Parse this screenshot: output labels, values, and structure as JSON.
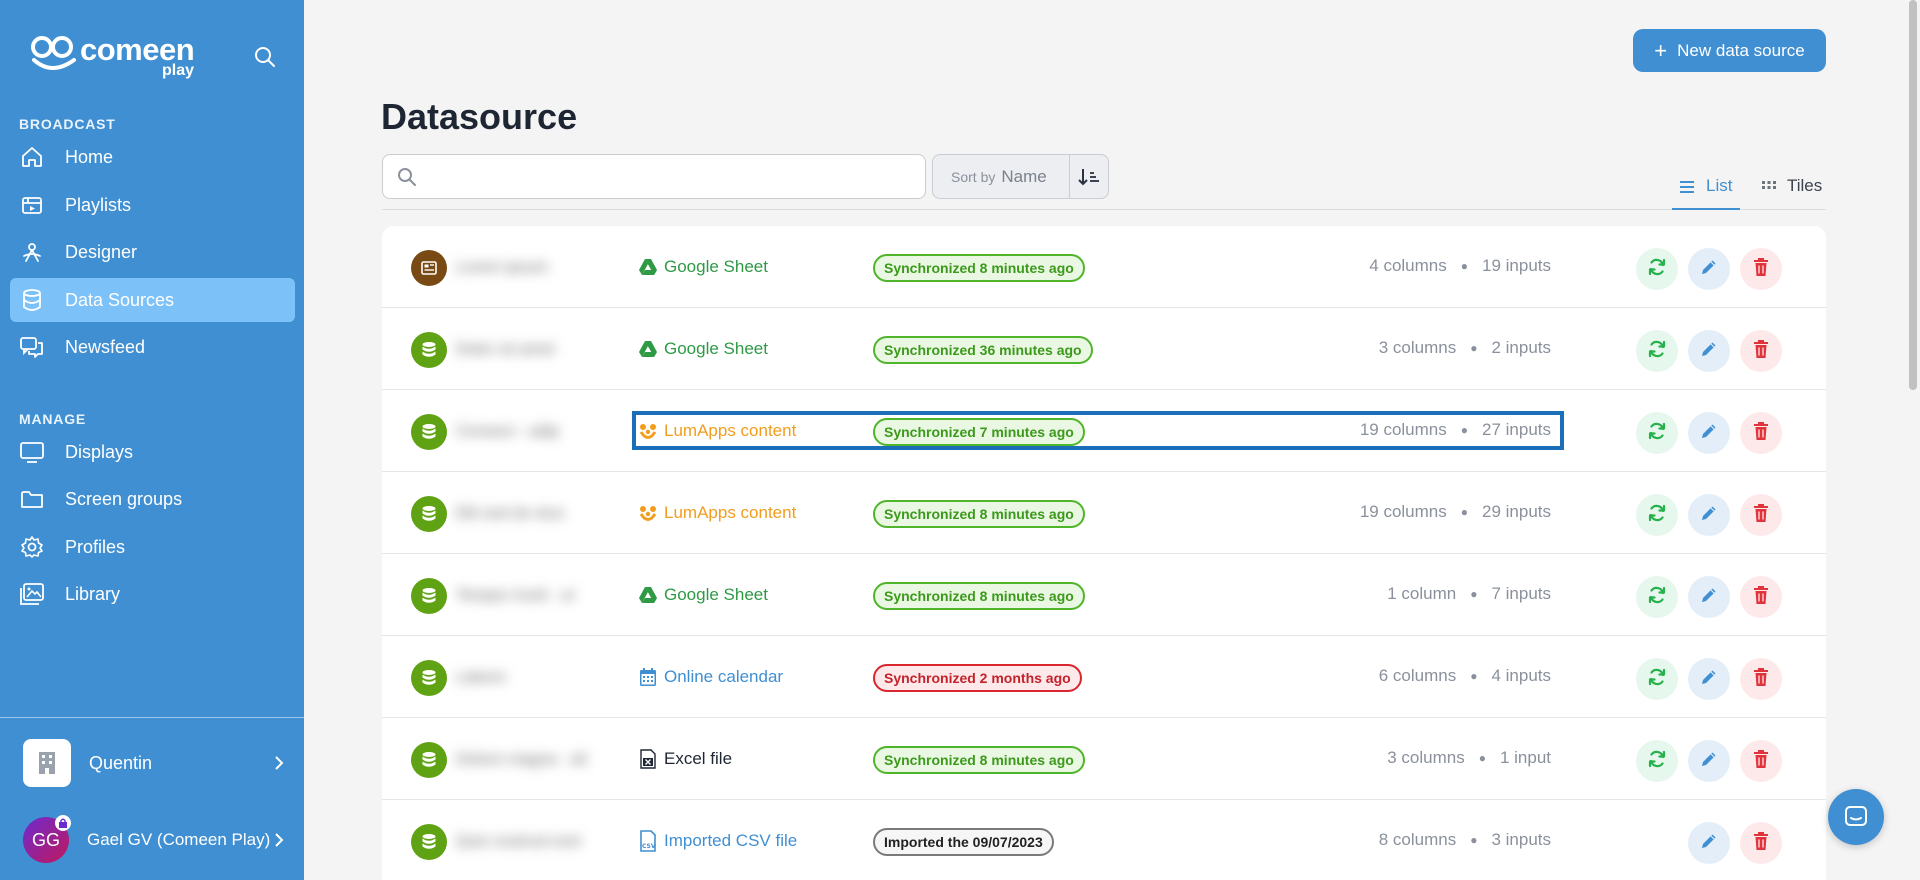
{
  "brand": {
    "name": "comeen",
    "sub": "play"
  },
  "sidebar": {
    "sections": [
      {
        "label": "BROADCAST"
      },
      {
        "label": "MANAGE"
      }
    ],
    "items": [
      {
        "label": "Home",
        "icon": "home-icon"
      },
      {
        "label": "Playlists",
        "icon": "playlist-icon"
      },
      {
        "label": "Designer",
        "icon": "designer-icon"
      },
      {
        "label": "Data Sources",
        "icon": "database-icon",
        "active": true
      },
      {
        "label": "Newsfeed",
        "icon": "newsfeed-icon"
      },
      {
        "label": "Displays",
        "icon": "display-icon"
      },
      {
        "label": "Screen groups",
        "icon": "folder-icon"
      },
      {
        "label": "Profiles",
        "icon": "gear-icon"
      },
      {
        "label": "Library",
        "icon": "library-icon"
      }
    ],
    "org": {
      "name": "Quentin"
    },
    "user": {
      "initials": "GG",
      "name": "Gael GV (Comeen Play)"
    }
  },
  "header": {
    "new_button": "New data source",
    "title": "Datasource"
  },
  "toolbar": {
    "search_placeholder": "",
    "sort_by_label": "Sort by",
    "sort_value": "Name",
    "view_list": "List",
    "view_tiles": "Tiles"
  },
  "rows": [
    {
      "name": "Lorem ipsum",
      "avatar_color": "#7a4a14",
      "avatar_icon": "news-icon",
      "type": "Google Sheet",
      "type_icon": "google-drive-icon",
      "type_color": "#2e9a46",
      "status": "Synchronized 8 minutes ago",
      "status_kind": "ok",
      "columns": "4 columns",
      "inputs": "19 inputs",
      "sync": true
    },
    {
      "name": "Dolor sit amet",
      "avatar_color": "#5fa314",
      "avatar_icon": "database-icon",
      "type": "Google Sheet",
      "type_icon": "google-drive-icon",
      "type_color": "#2e9a46",
      "status": "Synchronized 36 minutes ago",
      "status_kind": "ok",
      "columns": "3 columns",
      "inputs": "2 inputs",
      "sync": true
    },
    {
      "name": "Consect - adip",
      "avatar_color": "#5fa314",
      "avatar_icon": "database-icon",
      "type": "LumApps content",
      "type_icon": "lumapps-icon",
      "type_color": "#f29d1c",
      "status": "Synchronized 7 minutes ago",
      "status_kind": "ok",
      "columns": "19 columns",
      "inputs": "27 inputs",
      "sync": true
    },
    {
      "name": "Elit sed do eius",
      "avatar_color": "#5fa314",
      "avatar_icon": "database-icon",
      "type": "LumApps content",
      "type_icon": "lumapps-icon",
      "type_color": "#f29d1c",
      "status": "Synchronized 8 minutes ago",
      "status_kind": "ok",
      "columns": "19 columns",
      "inputs": "29 inputs",
      "sync": true
    },
    {
      "name": "Tempor incid - ut",
      "avatar_color": "#5fa314",
      "avatar_icon": "database-icon",
      "type": "Google Sheet",
      "type_icon": "google-drive-icon",
      "type_color": "#2e9a46",
      "status": "Synchronized 8 minutes ago",
      "status_kind": "ok",
      "columns": "1 column",
      "inputs": "7 inputs",
      "sync": true
    },
    {
      "name": "Labore",
      "avatar_color": "#5fa314",
      "avatar_icon": "database-icon",
      "type": "Online calendar",
      "type_icon": "calendar-icon",
      "type_color": "#3f8fd2",
      "status": "Synchronized 2 months ago",
      "status_kind": "old",
      "columns": "6 columns",
      "inputs": "4 inputs",
      "sync": true
    },
    {
      "name": "Dolore magna - ali",
      "avatar_color": "#5fa314",
      "avatar_icon": "database-icon",
      "type": "Excel file",
      "type_icon": "excel-icon",
      "type_color": "#1f2633",
      "status": "Synchronized 8 minutes ago",
      "status_kind": "ok",
      "columns": "3 columns",
      "inputs": "1 input",
      "sync": true
    },
    {
      "name": "Quis nostrud exer",
      "avatar_color": "#5fa314",
      "avatar_icon": "database-icon",
      "type": "Imported CSV file",
      "type_icon": "csv-icon",
      "type_color": "#3f8fd2",
      "status": "Imported the 09/07/2023",
      "status_kind": "imp",
      "columns": "8 columns",
      "inputs": "3 inputs",
      "sync": false
    }
  ]
}
